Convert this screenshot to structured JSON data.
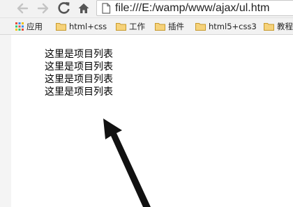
{
  "browser": {
    "address_url": "file:///E:/wamp/www/ajax/ul.htm",
    "icons": {
      "back": "back-arrow-icon",
      "forward": "forward-arrow-icon",
      "reload": "reload-icon",
      "home": "home-icon",
      "page": "page-file-icon"
    }
  },
  "bookmarks": {
    "apps_label": "应用",
    "items": [
      {
        "label": "html+css",
        "icon": "folder-icon"
      },
      {
        "label": "工作",
        "icon": "folder-icon"
      },
      {
        "label": "插件",
        "icon": "folder-icon"
      },
      {
        "label": "html5+css3",
        "icon": "folder-icon"
      },
      {
        "label": "教程",
        "icon": "folder-icon"
      }
    ]
  },
  "page": {
    "list_items": [
      "这里是项目列表",
      "这里是项目列表",
      "这里是项目列表",
      "这里是项目列表"
    ]
  },
  "colors": {
    "folder": "#e8b84a",
    "toolbar_bg": "#f2f2f2",
    "arrow": "#111111"
  }
}
